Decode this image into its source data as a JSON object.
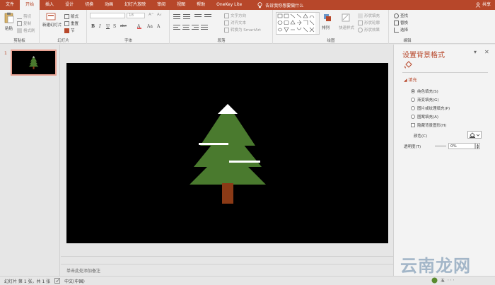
{
  "tabs": [
    "文件",
    "开始",
    "插入",
    "设计",
    "切换",
    "动画",
    "幻灯片放映",
    "审阅",
    "视图",
    "帮助",
    "OneKey Lite"
  ],
  "active_tab": 1,
  "tell_me": "告诉我你想要做什么",
  "share": "共享",
  "ribbon": {
    "clipboard": {
      "paste": "粘贴",
      "cut": "剪切",
      "copy": "复制",
      "format_painter": "格式刷",
      "label": "剪贴板"
    },
    "slides": {
      "new_slide": "新建幻灯片",
      "layout": "版式",
      "reset": "重置",
      "section": "节",
      "label": "幻灯片"
    },
    "font": {
      "font_name": "",
      "font_size": "18",
      "label": "字体",
      "bold": "B",
      "italic": "I",
      "underline": "U",
      "shadow": "S",
      "strike": "abc"
    },
    "paragraph": {
      "text_direction": "文字方向",
      "align_text": "对齐文本",
      "smartart": "转换为 SmartArt",
      "label": "段落"
    },
    "drawing": {
      "arrange": "排列",
      "quick_styles": "快速样式",
      "shape_fill": "形状填充",
      "shape_outline": "形状轮廓",
      "shape_effects": "形状效果",
      "label": "绘图"
    },
    "editing": {
      "find": "查找",
      "replace": "替换",
      "select": "选择",
      "label": "编辑"
    }
  },
  "thumbnail": {
    "number": "1"
  },
  "notes_placeholder": "单击此处添加备注",
  "panel": {
    "title": "设置背景格式",
    "section": "填充",
    "options": [
      {
        "label": "纯色填充(S)",
        "selected": true
      },
      {
        "label": "渐变填充(G)",
        "selected": false
      },
      {
        "label": "图片或纹理填充(P)",
        "selected": false
      },
      {
        "label": "图案填充(A)",
        "selected": false
      }
    ],
    "hide_bg": "隐藏背景图形(H)",
    "color_label": "颜色(C)",
    "transparency_label": "透明度(T)",
    "transparency_value": "0%"
  },
  "status": {
    "slide_info": "幻灯片 第 1 张，共 1 张",
    "language": "中文(中国)"
  },
  "watermark": "云南龙网",
  "watermark_badge": "五",
  "colors": {
    "accent": "#b7472a",
    "tree_green": "#4a7a2e",
    "trunk": "#8b3a16",
    "snow": "#ffffff",
    "slide_bg": "#000000"
  }
}
